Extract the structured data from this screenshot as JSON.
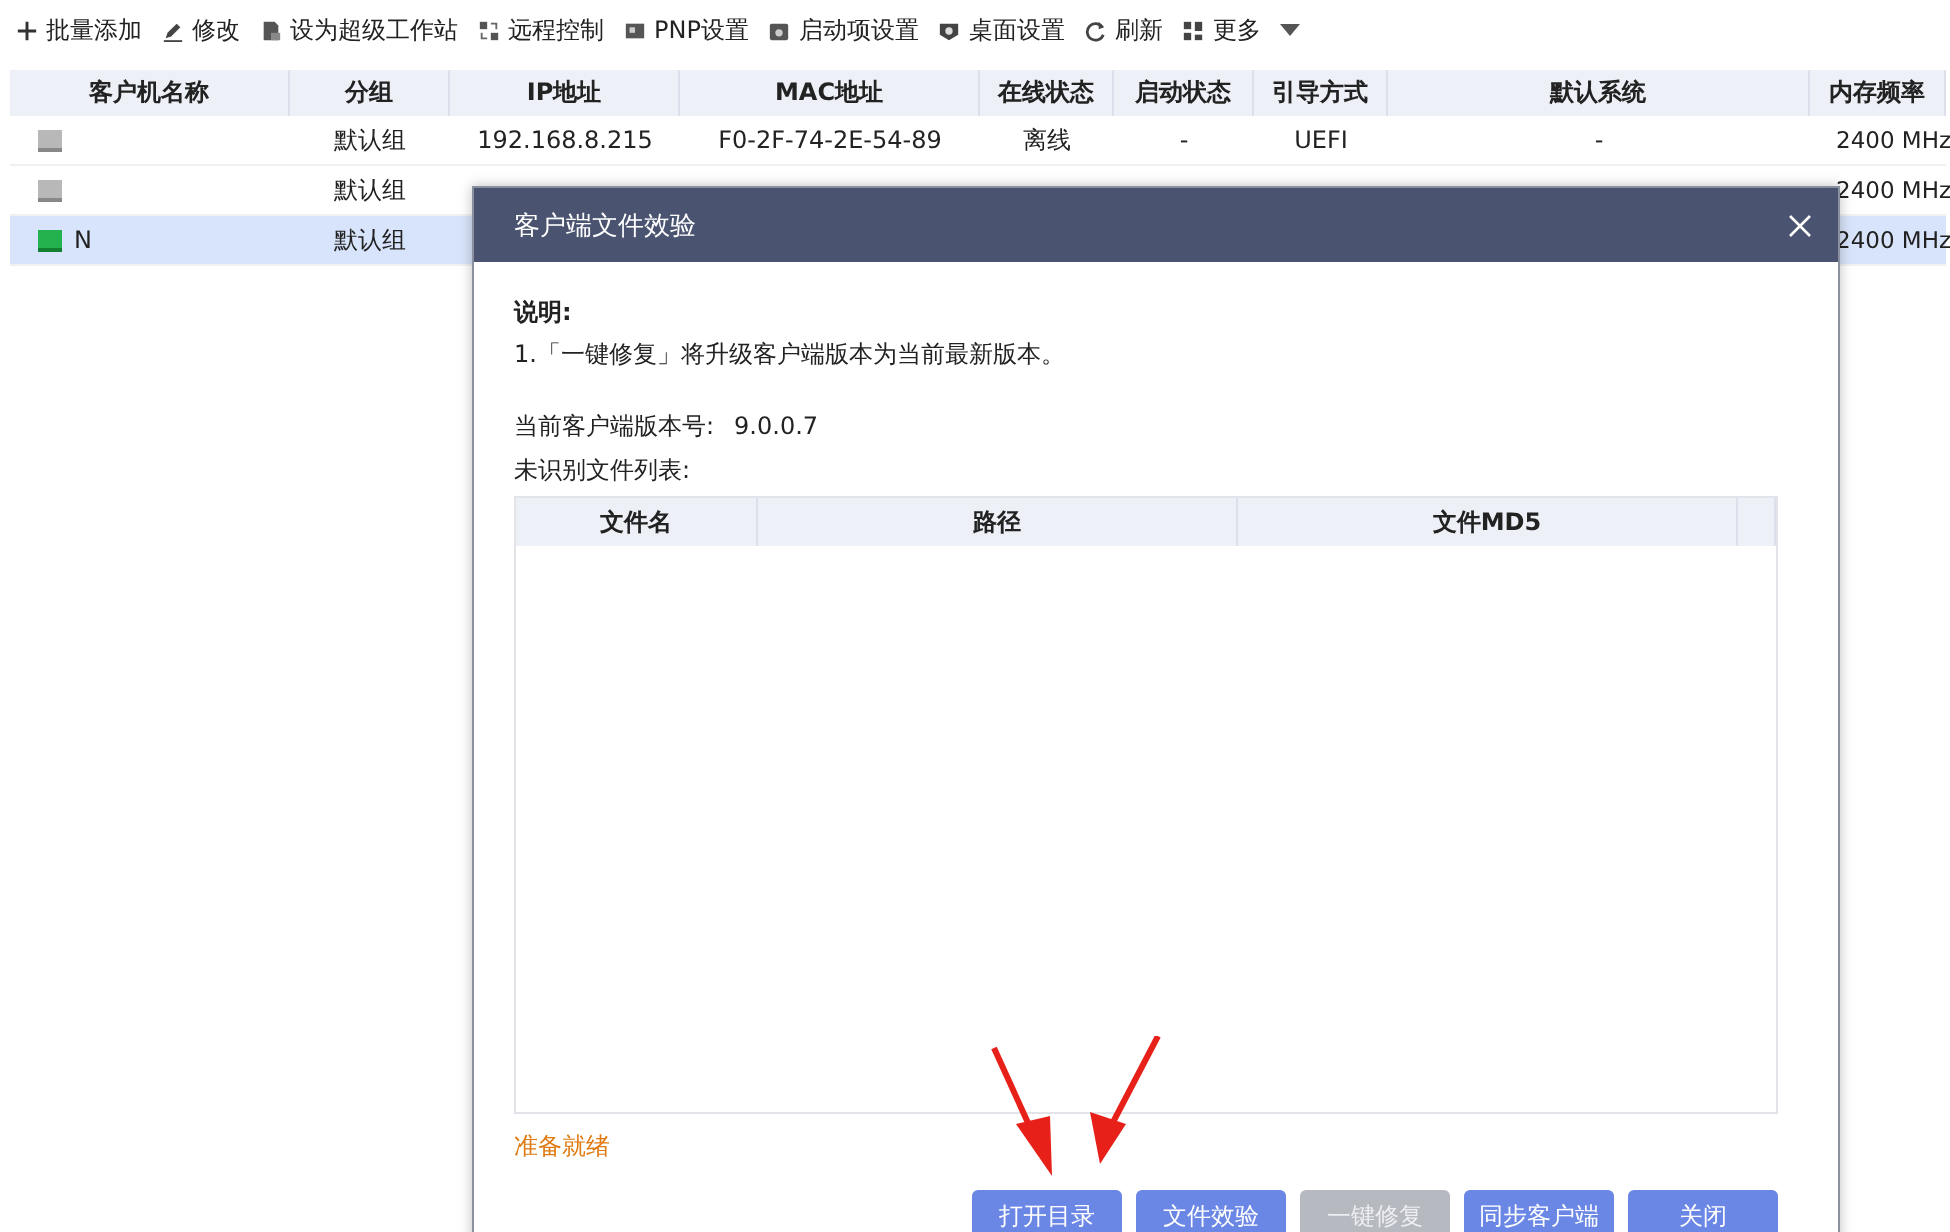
{
  "toolbar": [
    {
      "kind": "add",
      "label": "批量添加"
    },
    {
      "kind": "edit",
      "label": "修改"
    },
    {
      "kind": "workstation",
      "label": "设为超级工作站"
    },
    {
      "kind": "remote",
      "label": "远程控制"
    },
    {
      "kind": "pnp",
      "label": "PNP设置"
    },
    {
      "kind": "startup",
      "label": "启动项设置"
    },
    {
      "kind": "desktop",
      "label": "桌面设置"
    },
    {
      "kind": "refresh",
      "label": "刷新"
    },
    {
      "kind": "more",
      "label": "更多"
    }
  ],
  "table": {
    "columns": [
      "客户机名称",
      "分组",
      "IP地址",
      "MAC地址",
      "在线状态",
      "启动状态",
      "引导方式",
      "默认系统",
      "内存频率"
    ],
    "rows": [
      {
        "online": false,
        "selected": false,
        "cells": [
          "",
          "默认组",
          "192.168.8.215",
          "F0-2F-74-2E-54-89",
          "离线",
          "-",
          "UEFI",
          "-",
          "2400 MHz"
        ]
      },
      {
        "online": false,
        "selected": false,
        "cells": [
          "",
          "默认组",
          "",
          "",
          "",
          "",
          "",
          "",
          "2400 MHz"
        ]
      },
      {
        "online": true,
        "selected": true,
        "cells": [
          "N",
          "默认组",
          "",
          "",
          "",
          "",
          "",
          "",
          "2400 MHz"
        ]
      }
    ]
  },
  "dialog": {
    "title": "客户端文件效验",
    "note_heading": "说明:",
    "note": "1.「一键修复」将升级客户端版本为当前最新版本。",
    "version_label": "当前客户端版本号:",
    "version": "9.0.0.7",
    "list_label": "未识别文件列表:",
    "file_table": {
      "columns": [
        "文件名",
        "路径",
        "文件MD5"
      ]
    },
    "status": "准备就绪",
    "buttons": [
      {
        "label": "打开目录",
        "disabled": false
      },
      {
        "label": "文件效验",
        "disabled": false
      },
      {
        "label": "一键修复",
        "disabled": true
      },
      {
        "label": "同步客户端",
        "disabled": false
      },
      {
        "label": "关闭",
        "disabled": false
      }
    ]
  }
}
